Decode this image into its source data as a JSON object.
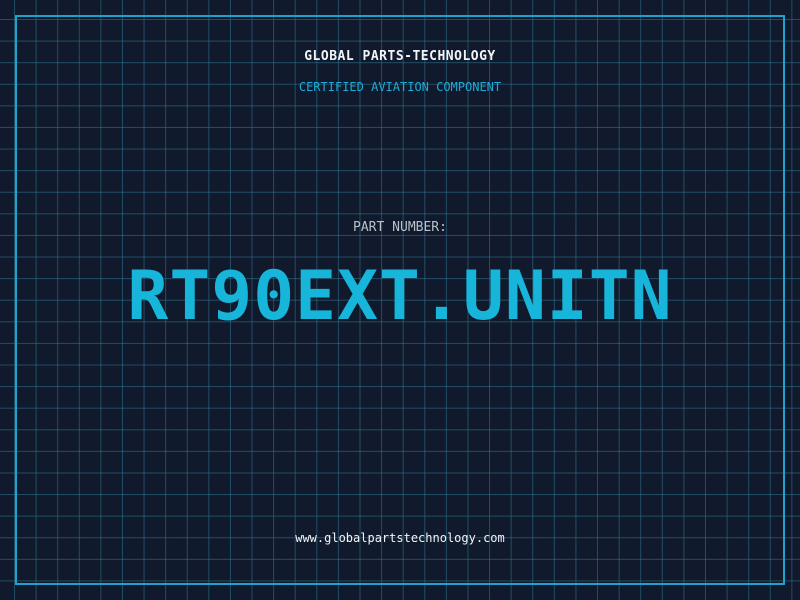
{
  "header": {
    "company": "GLOBAL PARTS-TECHNOLOGY",
    "tagline": "CERTIFIED AVIATION COMPONENT"
  },
  "part": {
    "label": "PART NUMBER:",
    "number": "RT90EXT.UNITN"
  },
  "footer": {
    "url": "www.globalpartstechnology.com"
  },
  "colors": {
    "background": "#111a2c",
    "grid": "#2e7896",
    "accent": "#18b5da",
    "text": "#f2f5f8"
  }
}
